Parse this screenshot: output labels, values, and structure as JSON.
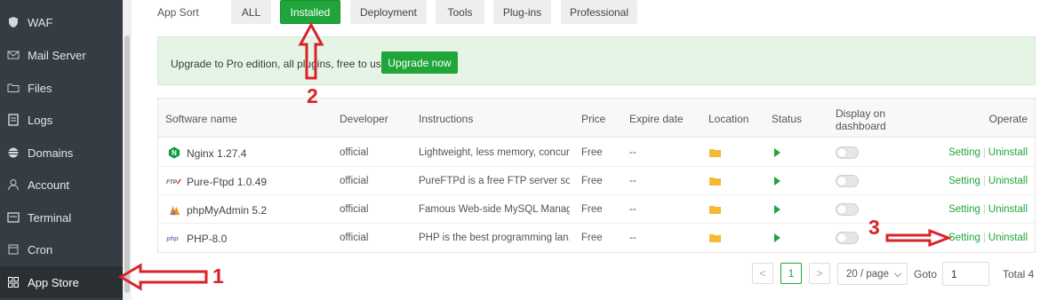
{
  "sidebar": {
    "items": [
      {
        "label": "WAF",
        "icon": "shield-icon"
      },
      {
        "label": "Mail Server",
        "icon": "mail-icon"
      },
      {
        "label": "Files",
        "icon": "folder-icon"
      },
      {
        "label": "Logs",
        "icon": "logs-icon"
      },
      {
        "label": "Domains",
        "icon": "globe-icon"
      },
      {
        "label": "Account",
        "icon": "user-icon"
      },
      {
        "label": "Terminal",
        "icon": "terminal-icon"
      },
      {
        "label": "Cron",
        "icon": "calendar-icon"
      },
      {
        "label": "App Store",
        "icon": "grid-icon",
        "active": true
      }
    ]
  },
  "app_sort": {
    "label": "App Sort",
    "tabs": [
      {
        "label": "ALL"
      },
      {
        "label": "Installed",
        "active": true
      },
      {
        "label": "Deployment"
      },
      {
        "label": "Tools"
      },
      {
        "label": "Plug-ins"
      },
      {
        "label": "Professional"
      }
    ]
  },
  "banner": {
    "text": "Upgrade to Pro edition, all plugins, free to use!",
    "button": "Upgrade now"
  },
  "table": {
    "headers": {
      "software_name": "Software name",
      "developer": "Developer",
      "instructions": "Instructions",
      "price": "Price",
      "expire_date": "Expire date",
      "location": "Location",
      "status": "Status",
      "display_on_dashboard": "Display on dashboard",
      "operate": "Operate"
    },
    "rows": [
      {
        "name": "Nginx 1.27.4",
        "icon": "nginx-icon",
        "developer": "official",
        "instructions": "Lightweight, less memory, concurr...",
        "price": "Free",
        "expire": "--",
        "setting": "Setting",
        "uninstall": "Uninstall"
      },
      {
        "name": "Pure-Ftpd 1.0.49",
        "icon": "ftp-icon",
        "developer": "official",
        "instructions": "PureFTPd is a free FTP server soft...",
        "price": "Free",
        "expire": "--",
        "setting": "Setting",
        "uninstall": "Uninstall"
      },
      {
        "name": "phpMyAdmin 5.2",
        "icon": "phpmyadmin-icon",
        "developer": "official",
        "instructions": "Famous Web-side MySQL Manag...",
        "price": "Free",
        "expire": "--",
        "setting": "Setting",
        "uninstall": "Uninstall"
      },
      {
        "name": "PHP-8.0",
        "icon": "php-icon",
        "developer": "official",
        "instructions": "PHP is the best programming lan...",
        "price": "Free",
        "expire": "--",
        "setting": "Setting",
        "uninstall": "Uninstall"
      }
    ]
  },
  "pagination": {
    "prev": "<",
    "current_page": "1",
    "next": ">",
    "page_size": "20 / page",
    "goto_label": "Goto",
    "goto_value": "1",
    "total": "Total 4"
  },
  "annotations": {
    "one": "1",
    "two": "2",
    "three": "3",
    "color": "#d9232b"
  },
  "colors": {
    "accent": "#20a53a",
    "sidebar_bg": "#353c43"
  }
}
